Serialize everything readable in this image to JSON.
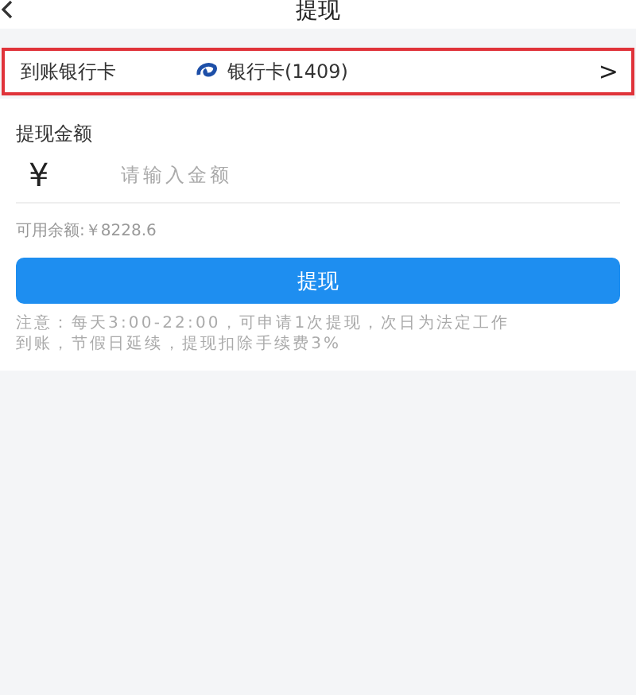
{
  "header": {
    "title": "提现"
  },
  "card_row": {
    "label": "到账银行卡",
    "value": "银行卡(1409)",
    "chevron": ">",
    "highlighted": true
  },
  "amount": {
    "label": "提现金额",
    "currency": "¥",
    "placeholder": "请输入金额"
  },
  "balance": "可用余额:￥8228.6",
  "submit_button": "提现",
  "note_lines": [
    "注意：每天3:00-22:00，可申请1次提现，次日为法定工作",
    "到账，节假日延续，提现扣除手续费3%"
  ]
}
